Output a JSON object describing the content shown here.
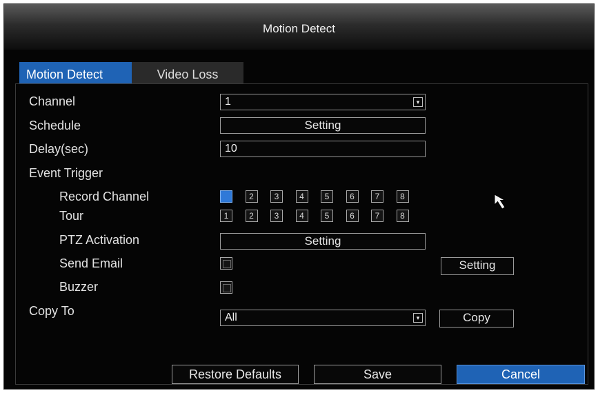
{
  "window": {
    "title": "Motion Detect"
  },
  "tabs": [
    {
      "label": "Motion Detect",
      "active": true
    },
    {
      "label": "Video Loss",
      "active": false
    }
  ],
  "form": {
    "channel": {
      "label": "Channel",
      "value": "1"
    },
    "schedule": {
      "label": "Schedule",
      "button": "Setting"
    },
    "delay": {
      "label": "Delay(sec)",
      "value": "10"
    },
    "event_trigger": {
      "label": "Event Trigger"
    },
    "record_channel": {
      "label": "Record Channel",
      "boxes": [
        {
          "num": "1",
          "checked": true
        },
        {
          "num": "2",
          "checked": false
        },
        {
          "num": "3",
          "checked": false
        },
        {
          "num": "4",
          "checked": false
        },
        {
          "num": "5",
          "checked": false
        },
        {
          "num": "6",
          "checked": false
        },
        {
          "num": "7",
          "checked": false
        },
        {
          "num": "8",
          "checked": false
        }
      ]
    },
    "tour": {
      "label": "Tour",
      "boxes": [
        {
          "num": "1"
        },
        {
          "num": "2"
        },
        {
          "num": "3"
        },
        {
          "num": "4"
        },
        {
          "num": "5"
        },
        {
          "num": "6"
        },
        {
          "num": "7"
        },
        {
          "num": "8"
        }
      ]
    },
    "ptz": {
      "label": "PTZ Activation",
      "button": "Setting"
    },
    "send_email": {
      "label": "Send Email",
      "checked": false,
      "button": "Setting"
    },
    "buzzer": {
      "label": "Buzzer",
      "checked": false
    },
    "copy_to": {
      "label": "Copy To",
      "value": "All",
      "button": "Copy"
    }
  },
  "footer": {
    "restore": "Restore Defaults",
    "save": "Save",
    "cancel": "Cancel"
  },
  "colors": {
    "accent": "#1f63b5",
    "background": "#050505"
  },
  "icons": {
    "dropdown": "dropdown-arrow-icon",
    "cursor": "mouse-pointer-icon"
  }
}
